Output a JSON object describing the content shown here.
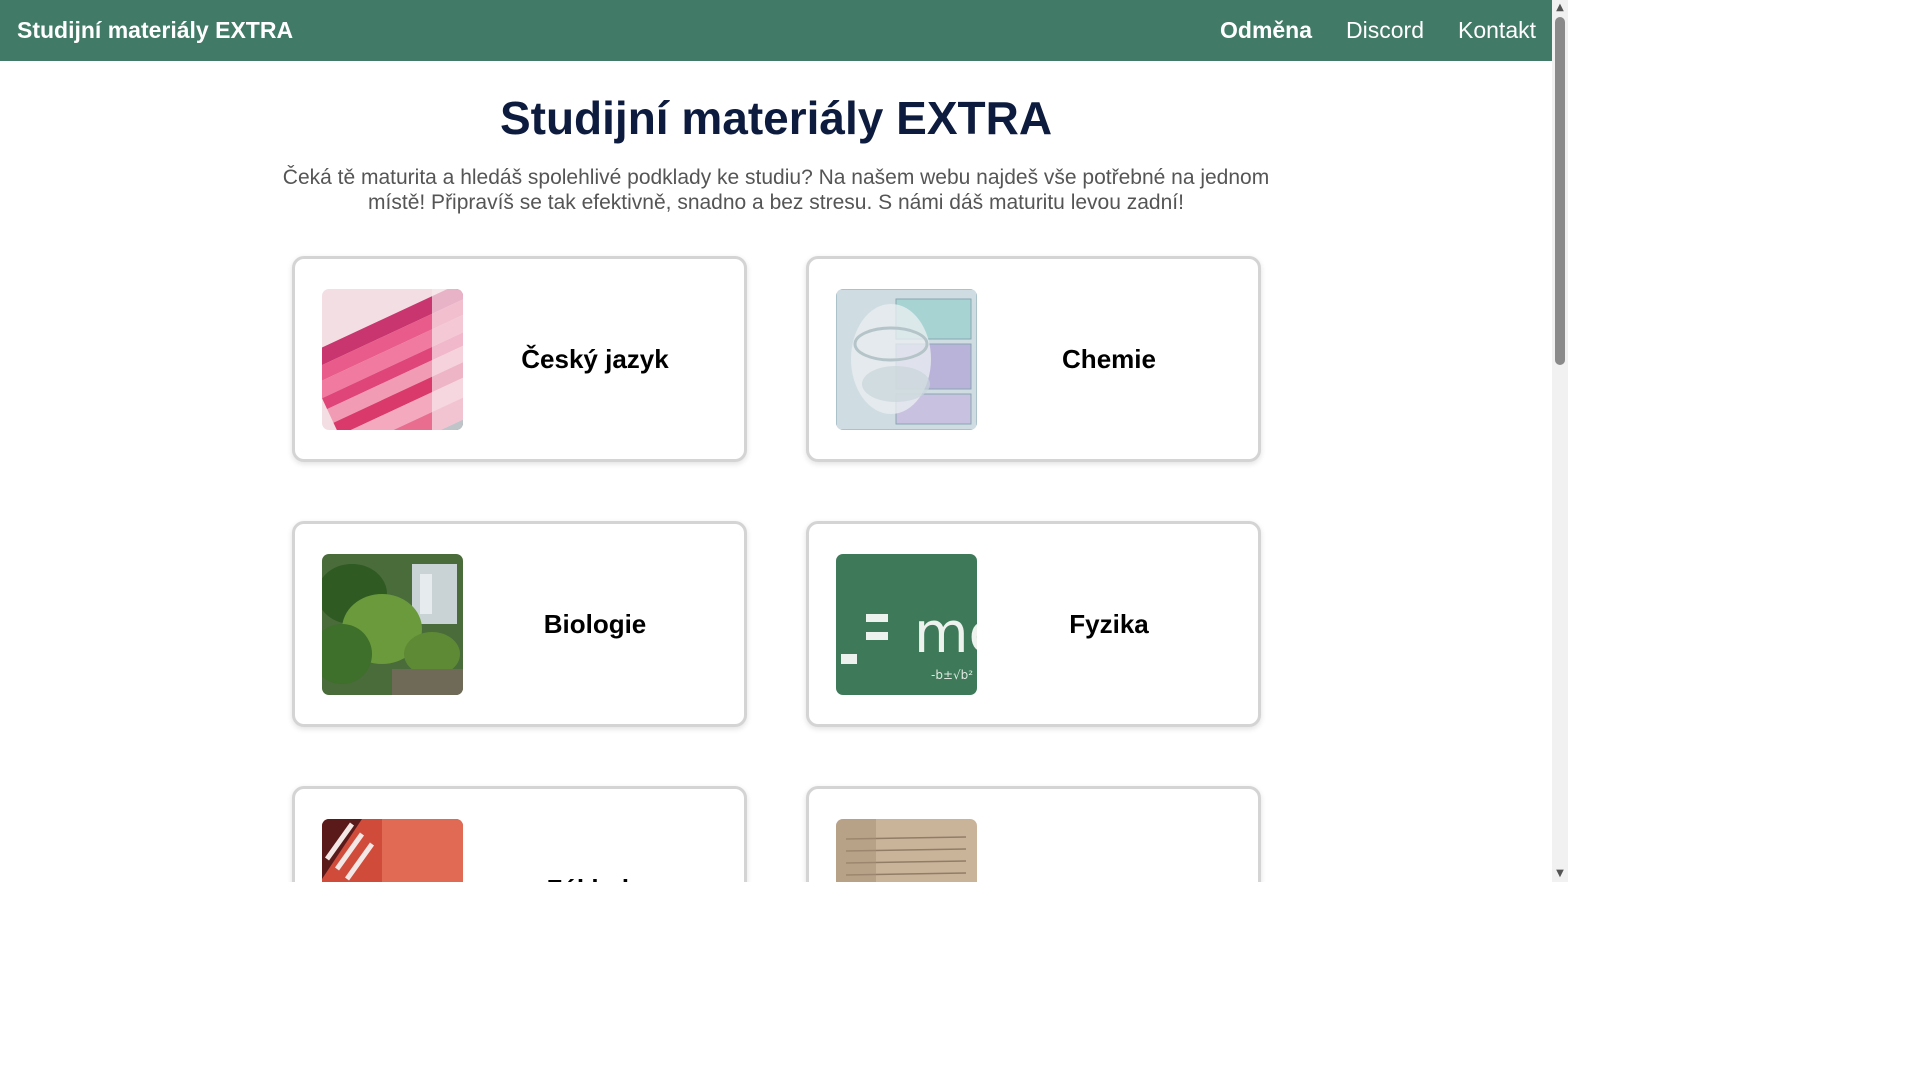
{
  "navbar": {
    "brand": "Studijní materiály EXTRA",
    "links": [
      {
        "label": "Odměna",
        "active": true
      },
      {
        "label": "Discord",
        "active": false
      },
      {
        "label": "Kontakt",
        "active": false
      }
    ]
  },
  "hero": {
    "title": "Studijní materiály EXTRA",
    "text": "Čeká tě maturita a hledáš spolehlivé podklady ke studiu? Na našem webu najdeš vše potřebné na jednom místě! Připravíš se tak efektivně, snadno a bez stresu. S námi dáš maturitu levou zadní!"
  },
  "subjects": [
    {
      "title": "Český jazyk",
      "image": "pink-books-image"
    },
    {
      "title": "Chemie",
      "image": "periodic-table-beaker-image"
    },
    {
      "title": "Biologie",
      "image": "greenhouse-plants-image"
    },
    {
      "title": "Fyzika",
      "image": "chalkboard-emc2-image"
    },
    {
      "title": "Základy",
      "image": "red-book-image"
    },
    {
      "title": "",
      "image": "old-paper-image"
    }
  ],
  "colors": {
    "navbar": "#417a66",
    "title": "#0d1b3e",
    "text": "#555555"
  }
}
